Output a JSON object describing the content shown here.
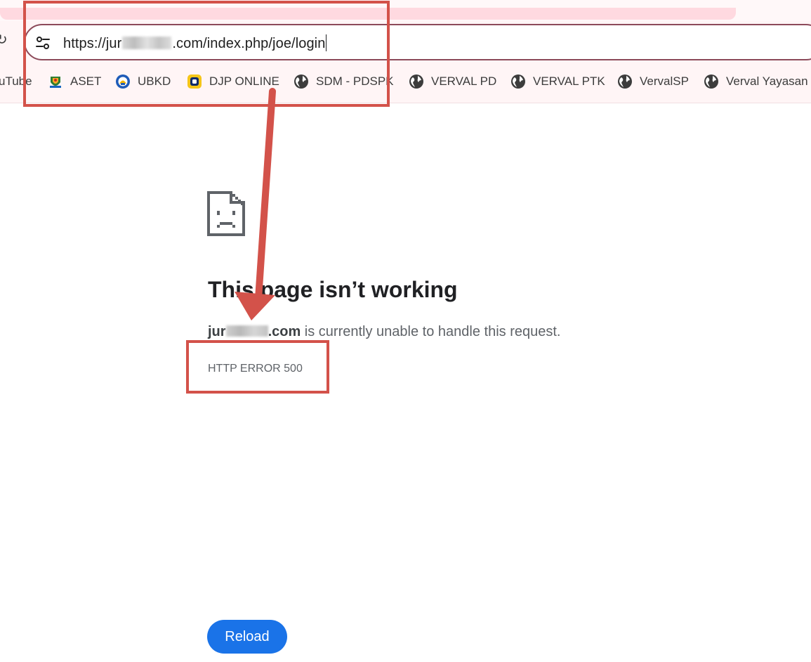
{
  "browser": {
    "address_bar": {
      "url_prefix": "https://jur",
      "url_suffix": ".com/index.php/joe/login"
    },
    "bookmarks": [
      {
        "label": "uTube",
        "icon": "youtube-icon"
      },
      {
        "label": "ASET",
        "icon": "aset-logo-icon"
      },
      {
        "label": "UBKD",
        "icon": "ubkd-logo-icon"
      },
      {
        "label": "DJP ONLINE",
        "icon": "djp-logo-icon"
      },
      {
        "label": "SDM - PDSPK",
        "icon": "globe-icon"
      },
      {
        "label": "VERVAL PD",
        "icon": "globe-icon"
      },
      {
        "label": "VERVAL PTK",
        "icon": "globe-icon"
      },
      {
        "label": "VervalSP",
        "icon": "globe-icon"
      },
      {
        "label": "Verval Yayasan",
        "icon": "globe-icon"
      }
    ]
  },
  "error_page": {
    "title": "This page isn’t working",
    "host_prefix": "jur",
    "host_suffix": ".com",
    "description": " is currently unable to handle this request.",
    "code": "HTTP ERROR 500",
    "reload_label": "Reload"
  },
  "colors": {
    "chrome_background": "#fff5f6",
    "tab_accent": "#ffd9e0",
    "omnibox_border": "#8c4a5a",
    "reload_button": "#1a73e8",
    "annotation_red": "#d3524a"
  }
}
